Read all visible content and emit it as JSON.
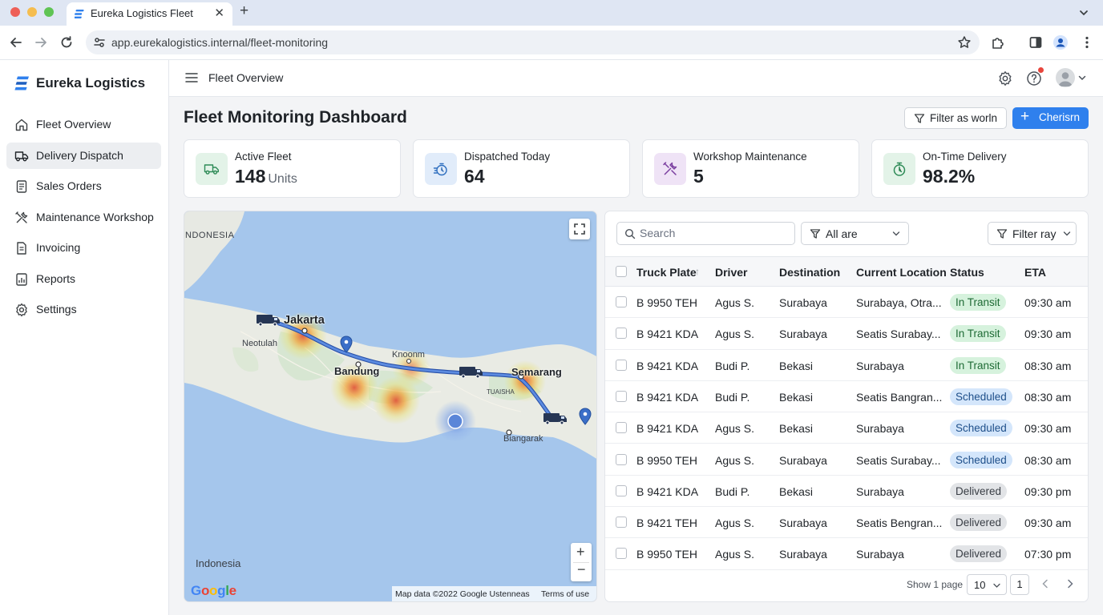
{
  "browser": {
    "tab_title": "Eureka Logistics Fleet",
    "url": "app.eurekalogistics.internal/fleet-monitoring"
  },
  "sidebar": {
    "brand": "Eureka Logistics",
    "items": [
      {
        "label": "Fleet Overview",
        "icon": "home-icon",
        "active": false
      },
      {
        "label": "Delivery Dispatch",
        "icon": "truck-icon",
        "active": true
      },
      {
        "label": "Sales Orders",
        "icon": "document-icon",
        "active": false
      },
      {
        "label": "Maintenance Workshop",
        "icon": "tools-icon",
        "active": false
      },
      {
        "label": "Invoicing",
        "icon": "invoice-icon",
        "active": false
      },
      {
        "label": "Reports",
        "icon": "reports-icon",
        "active": false
      },
      {
        "label": "Settings",
        "icon": "gear-icon",
        "active": false
      }
    ]
  },
  "topbar": {
    "title": "Fleet Overview"
  },
  "page": {
    "title": "Fleet Monitoring Dashboard",
    "filter_button": "Filter as worln",
    "primary_button": "Cherisrn"
  },
  "stats": [
    {
      "label": "Active Fleet",
      "value": "148",
      "unit": "Units",
      "icon": "truck-icon",
      "color": "#e3f3e8"
    },
    {
      "label": "Dispatched Today",
      "value": "64",
      "unit": "",
      "icon": "stopwatch-icon",
      "color": "#e1ecfa"
    },
    {
      "label": "Workshop Maintenance",
      "value": "5",
      "unit": "",
      "icon": "tools-icon",
      "color": "#efe3f6"
    },
    {
      "label": "On-Time Delivery",
      "value": "98.2%",
      "unit": "",
      "icon": "timer-icon",
      "color": "#e3f3e8"
    }
  ],
  "map": {
    "labels": {
      "region": "NDONESIA",
      "jakarta": "Jakarta",
      "neotulah": "Neotulah",
      "bandung": "Bandung",
      "knoonm": "Knoonm",
      "semarang": "Semarang",
      "tuaisha": "TUAISHA",
      "biangarak": "Biangarak",
      "country": "Indonesia"
    },
    "attribution": "Map data ©2022 Google Ustenneas",
    "terms": "Terms of use",
    "logo": "Google"
  },
  "table": {
    "search_placeholder": "Search",
    "filter_status": "All are",
    "filter_range": "Filter ray",
    "columns": [
      "Truck Plate",
      "Driver",
      "Destination",
      "Current Location",
      "Status",
      "ETA"
    ],
    "rows": [
      {
        "plate": "B 9950 TEH",
        "driver": "Agus S.",
        "destination": "Surabaya",
        "location": "Surabaya, Otra...",
        "status": "In Transit",
        "status_kind": "transit",
        "eta": "09:30 am"
      },
      {
        "plate": "B 9421 KDA",
        "driver": "Agus S.",
        "destination": "Surabaya",
        "location": "Seatis Surabay...",
        "status": "In Transit",
        "status_kind": "transit",
        "eta": "09:30 am"
      },
      {
        "plate": "B 9421 KDA",
        "driver": "Budi P.",
        "destination": "Bekasi",
        "location": "Surabaya",
        "status": "In Transit",
        "status_kind": "transit",
        "eta": "08:30 am"
      },
      {
        "plate": "B 9421 KDA",
        "driver": "Budi P.",
        "destination": "Bekasi",
        "location": "Seatis Bangran...",
        "status": "Scheduled",
        "status_kind": "scheduled",
        "eta": "08:30 am"
      },
      {
        "plate": "B 9421 KDA",
        "driver": "Agus S.",
        "destination": "Bekasi",
        "location": "Surabaya",
        "status": "Scheduled",
        "status_kind": "scheduled",
        "eta": "09:30 am"
      },
      {
        "plate": "B 9950 TEH",
        "driver": "Agus S.",
        "destination": "Surabaya",
        "location": "Seatis Surabay...",
        "status": "Scheduled",
        "status_kind": "scheduled",
        "eta": "08:30 am"
      },
      {
        "plate": "B 9421 KDA",
        "driver": "Budi P.",
        "destination": "Bekasi",
        "location": "Surabaya",
        "status": "Delivered",
        "status_kind": "delivered",
        "eta": "09:30 pm"
      },
      {
        "plate": "B 9421 TEH",
        "driver": "Agus S.",
        "destination": "Surabaya",
        "location": "Seatis Bengran...",
        "status": "Delivered",
        "status_kind": "delivered",
        "eta": "09:30 am"
      },
      {
        "plate": "B 9950 TEH",
        "driver": "Agus S.",
        "destination": "Surabaya",
        "location": "Surabaya",
        "status": "Delivered",
        "status_kind": "delivered",
        "eta": "07:30 pm"
      }
    ],
    "pagination": {
      "label": "Show 1 page",
      "page_size": "10",
      "current_page": "1"
    }
  },
  "colors": {
    "accent": "#2f80ed",
    "route": "#3d6fd6",
    "pin": "#3b6fc8"
  }
}
